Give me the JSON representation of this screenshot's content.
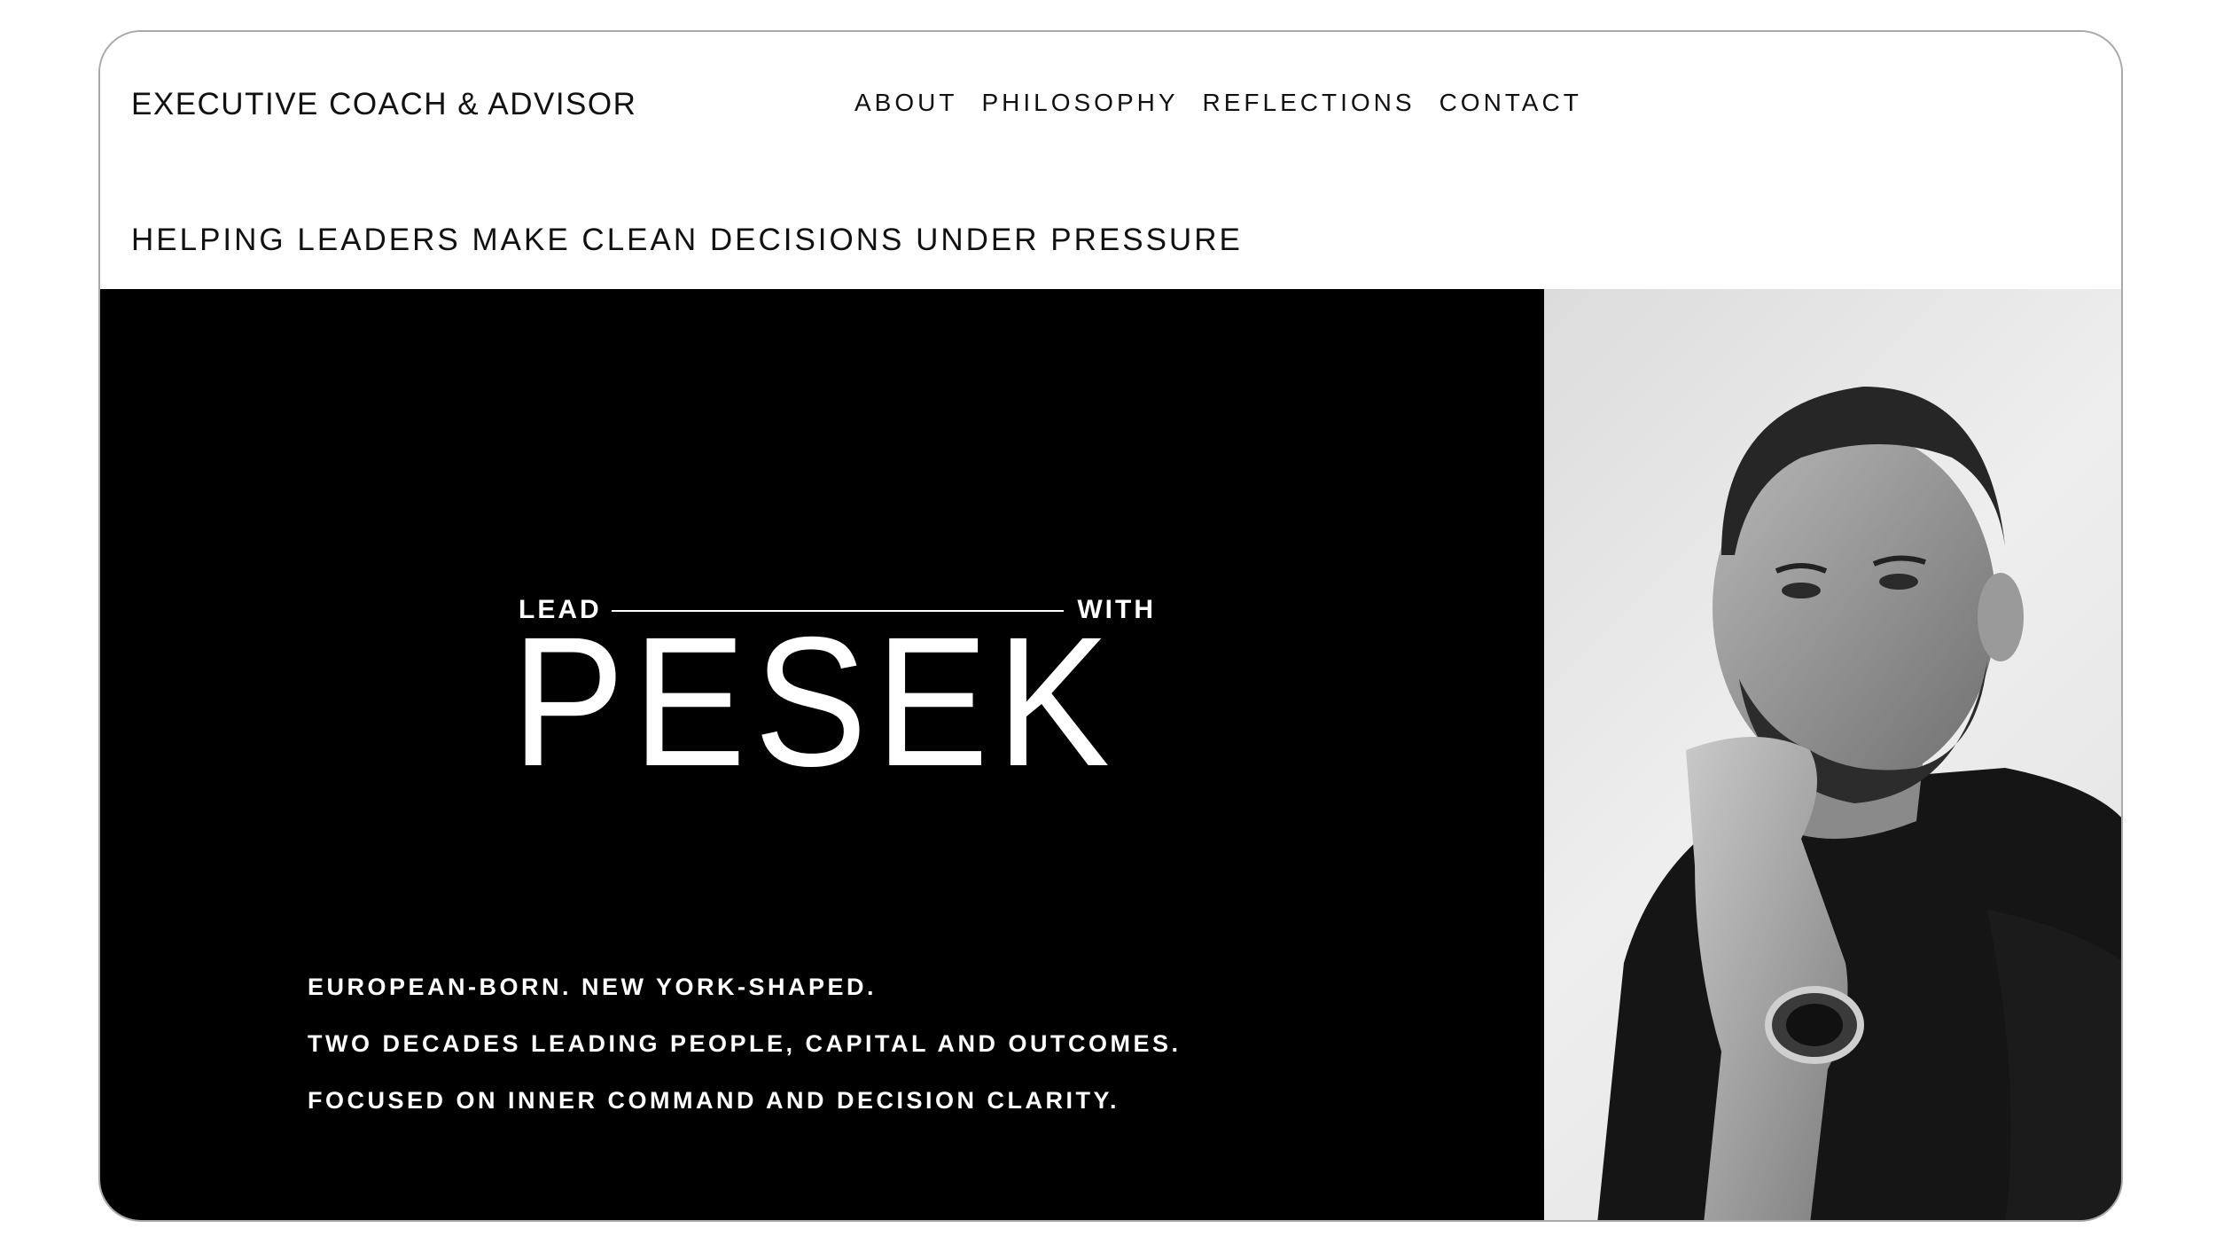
{
  "header": {
    "brand": "EXECUTIVE COACH & ADVISOR",
    "nav": [
      {
        "label": "ABOUT"
      },
      {
        "label": "PHILOSOPHY"
      },
      {
        "label": "REFLECTIONS"
      },
      {
        "label": "CONTACT"
      }
    ],
    "tagline": "HELPING LEADERS MAKE CLEAN DECISIONS UNDER PRESSURE"
  },
  "hero": {
    "lead_left": "LEAD",
    "lead_right": "WITH",
    "name": "PESEK",
    "bio": [
      "EUROPEAN-BORN. NEW YORK-SHAPED.",
      "TWO DECADES LEADING PEOPLE, CAPITAL AND OUTCOMES.",
      "FOCUSED ON INNER COMMAND AND DECISION CLARITY."
    ],
    "background_color": "#000000",
    "text_color": "#ffffff"
  }
}
